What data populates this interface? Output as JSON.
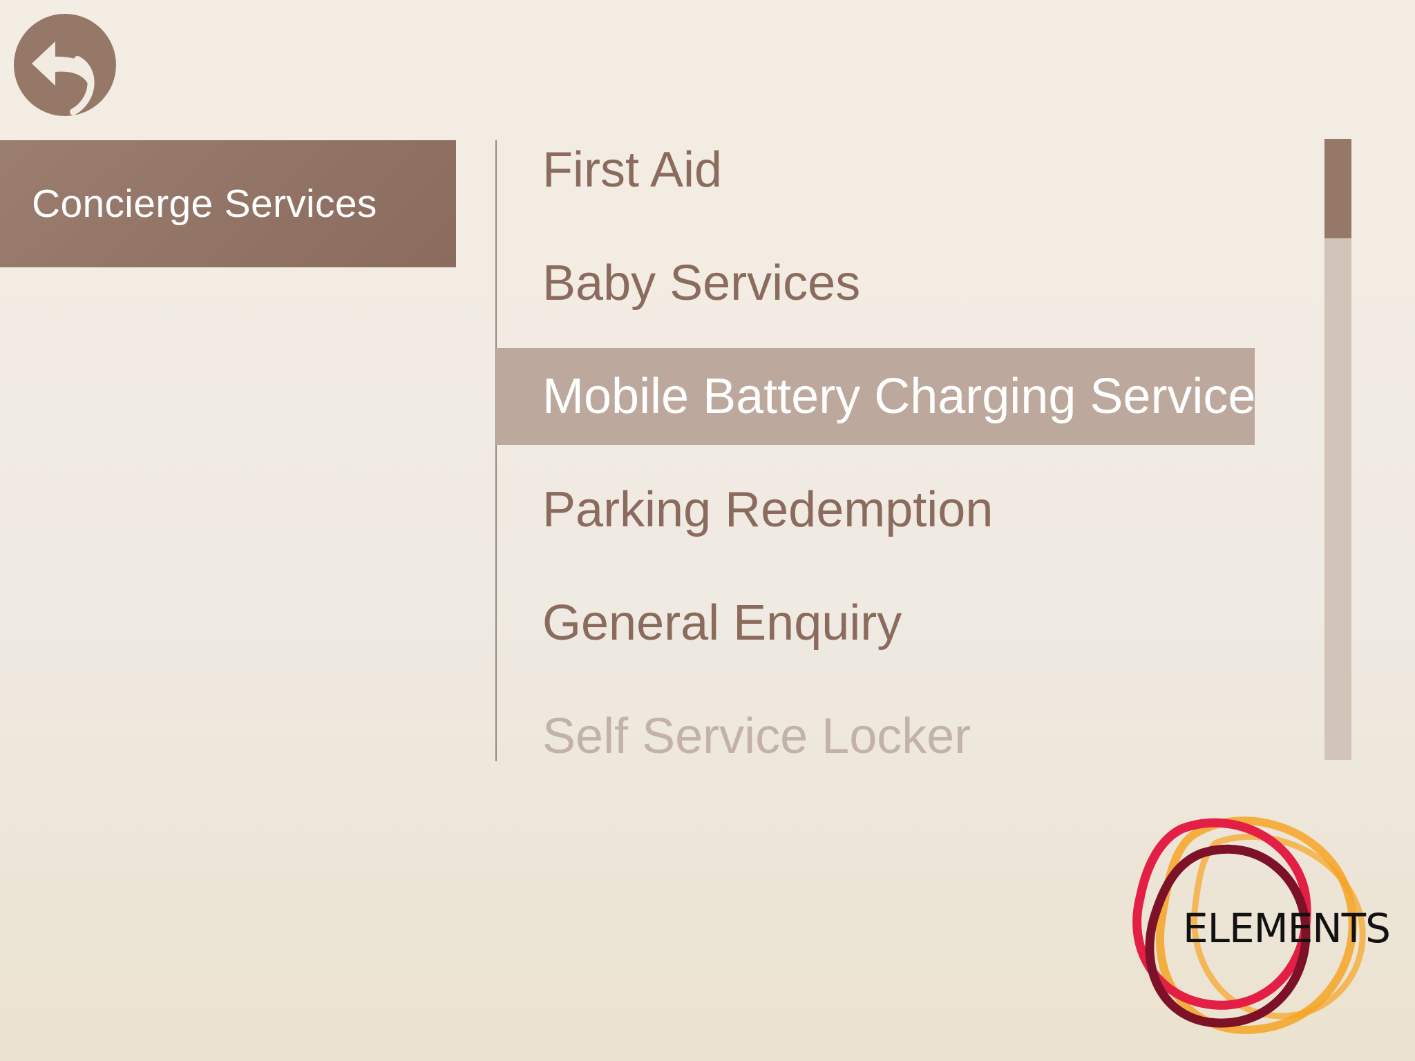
{
  "header": {
    "back_icon": "back-arrow-icon"
  },
  "sidebar": {
    "active_category": "Concierge Services"
  },
  "services": {
    "items": [
      {
        "label": "First Aid",
        "state": "normal"
      },
      {
        "label": "Baby Services",
        "state": "normal"
      },
      {
        "label": "Mobile Battery Charging Service",
        "state": "selected"
      },
      {
        "label": "Parking Redemption",
        "state": "normal"
      },
      {
        "label": "General Enquiry",
        "state": "normal"
      },
      {
        "label": "Self Service Locker",
        "state": "faded"
      }
    ]
  },
  "scrollbar": {
    "position_fraction": 0.0,
    "visible_fraction": 0.16
  },
  "logo": {
    "text": "ELEMENTS"
  },
  "colors": {
    "accent": "#957868",
    "selected_row": "#bca89c",
    "text": "#8a6b5d",
    "logo_red": "#e41f45",
    "logo_dark_red": "#7d1128",
    "logo_orange": "#f6a424"
  }
}
